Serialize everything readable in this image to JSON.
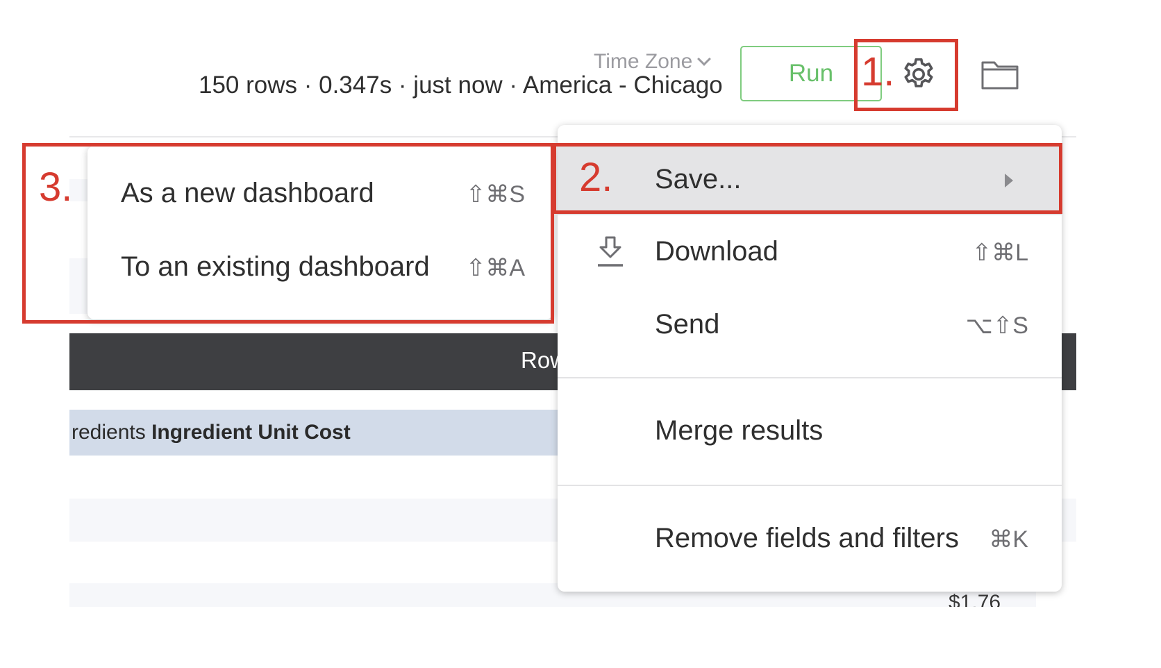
{
  "header": {
    "time_zone_label": "Time Zone",
    "status_line": "150 rows · 0.347s · just now · America - Chicago",
    "run_label": "Run"
  },
  "icons": {
    "settings": "gear-icon",
    "folder": "folder-icon",
    "download": "download-icon",
    "submenu_arrow": "caret-right-icon"
  },
  "table": {
    "dark_bar_label": "Row",
    "column_header_partial": "redients",
    "column_header_bold": "Ingredient Unit Cost",
    "visible_cell": "$1.76"
  },
  "gear_menu": {
    "items": [
      {
        "label": "Save...",
        "shortcut": ""
      },
      {
        "label": "Download",
        "shortcut": "⇧⌘L"
      },
      {
        "label": "Send",
        "shortcut": "⌥⇧S"
      },
      {
        "label": "Merge results",
        "shortcut": ""
      },
      {
        "label": "Remove fields and filters",
        "shortcut": "⌘K"
      }
    ]
  },
  "save_submenu": {
    "items": [
      {
        "label": "As a new dashboard",
        "shortcut": "⇧⌘S"
      },
      {
        "label": "To an existing dashboard",
        "shortcut": "⇧⌘A"
      }
    ]
  },
  "annotations": {
    "step1": "1.",
    "step2": "2.",
    "step3": "3.",
    "color": "#d63b2f"
  },
  "colors": {
    "run_green": "#68c06a",
    "dark_bar": "#3e3f42",
    "column_header_bg": "#d2dbe9",
    "highlight_bg": "#e4e4e6"
  }
}
